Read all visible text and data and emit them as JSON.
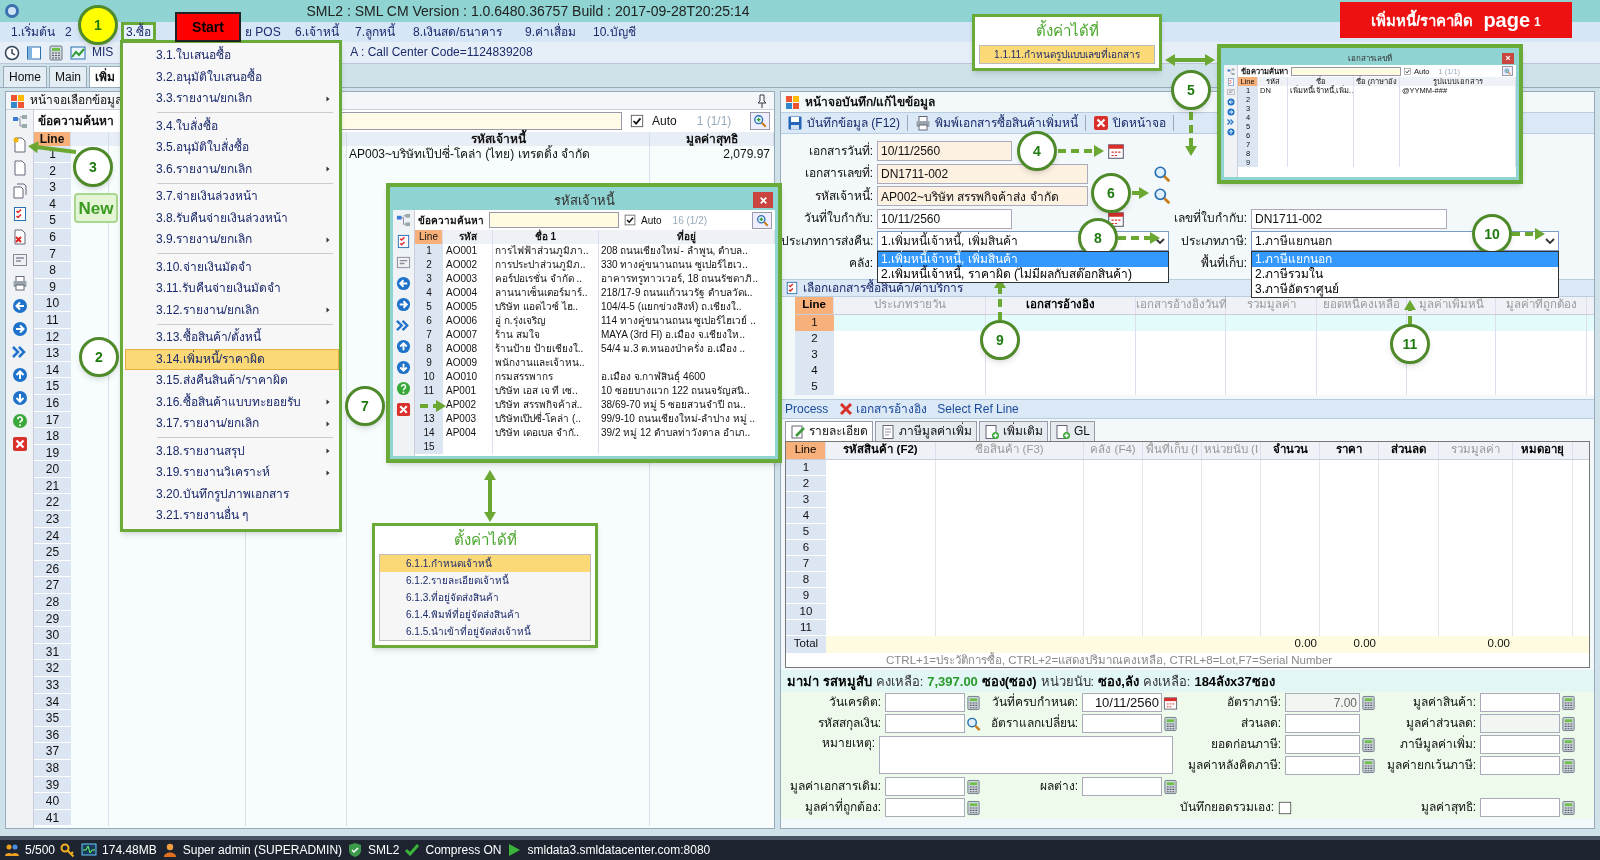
{
  "window": {
    "title": "SML2 : SML CM Version : 1.0.6480.36757  Build : 2017-09-28T20:25:14"
  },
  "menu_bar": [
    {
      "label": "1.เริ่มต้น",
      "selected": false
    },
    {
      "label": "2",
      "selected": false
    },
    {
      "label": "3.ซื้อ",
      "selected": true
    },
    {
      "label": "ย POS",
      "selected": false
    },
    {
      "label": "6.เจ้าหนี้",
      "selected": false
    },
    {
      "label": "7.ลูกหนี้",
      "selected": false
    },
    {
      "label": "8.เงินสด/ธนาคาร",
      "selected": false
    },
    {
      "label": "9.ค่าเสื่อม",
      "selected": false
    },
    {
      "label": "10.บัญชี",
      "selected": false
    }
  ],
  "toolbar": {
    "mis_label": "MIS",
    "info": "A : Call Center Code=1124839208"
  },
  "tabs": [
    {
      "label": "Home",
      "selected": false
    },
    {
      "label": "Main",
      "selected": false
    },
    {
      "label": "เพิ่ม",
      "selected": true
    }
  ],
  "left_panel": {
    "title": "หน้าจอเลือกข้อมูล",
    "search_label": "ข้อความค้นหา",
    "auto": {
      "label": "Auto",
      "checked": true
    },
    "count": "1 (1/1)",
    "columns": [
      "Line",
      "รหัสเจ้าหนี้",
      "มูลค่าสุทธิ"
    ],
    "rows": [
      {
        "code": "AP003~บริษัทเป๊ปซี่-โคล่า (ไทย) เทรดดิ้ง จำกัด",
        "amount": "2,079.97"
      }
    ],
    "lines": [
      "1",
      "2",
      "3",
      "4",
      "5",
      "6",
      "7",
      "8",
      "9",
      "10",
      "11",
      "12",
      "13",
      "14",
      "15",
      "16",
      "17",
      "18",
      "19",
      "20",
      "21",
      "22",
      "23",
      "24",
      "25",
      "26",
      "27",
      "28",
      "29",
      "30",
      "31",
      "32",
      "33",
      "34",
      "35",
      "36",
      "37",
      "38",
      "39",
      "40",
      "41"
    ]
  },
  "purchase_menu": {
    "groups": [
      [
        {
          "label": "3.1.ใบเสนอซื้อ",
          "submenu": false,
          "selected": false
        },
        {
          "label": "3.2.อนุมัติใบเสนอซื้อ",
          "submenu": false,
          "selected": false
        },
        {
          "label": "3.3.รายงาน/ยกเลิก",
          "submenu": true,
          "selected": false
        }
      ],
      [
        {
          "label": "3.4.ใบสั่งซื้อ",
          "submenu": false,
          "selected": false
        },
        {
          "label": "3.5.อนุมัติใบสั่งซื้อ",
          "submenu": false,
          "selected": false
        },
        {
          "label": "3.6.รายงาน/ยกเลิก",
          "submenu": true,
          "selected": false
        }
      ],
      [
        {
          "label": "3.7.จ่ายเงินล่วงหน้า",
          "submenu": false,
          "selected": false
        },
        {
          "label": "3.8.รับคืนจ่ายเงินล่วงหน้า",
          "submenu": false,
          "selected": false
        },
        {
          "label": "3.9.รายงาน/ยกเลิก",
          "submenu": true,
          "selected": false
        }
      ],
      [
        {
          "label": "3.10.จ่ายเงินมัดจำ",
          "submenu": false,
          "selected": false
        },
        {
          "label": "3.11.รับคืนจ่ายเงินมัดจำ",
          "submenu": false,
          "selected": false
        },
        {
          "label": "3.12.รายงาน/ยกเลิก",
          "submenu": true,
          "selected": false
        }
      ],
      [
        {
          "label": "3.13.ซื้อสินค้า/ตั้งหนี้",
          "submenu": false,
          "selected": false
        },
        {
          "label": "3.14.เพิ่มหนี้/ราคาผิด",
          "submenu": false,
          "selected": true
        },
        {
          "label": "3.15.ส่งคืนสินค้า/ราคาผิด",
          "submenu": false,
          "selected": false
        },
        {
          "label": "3.16.ซื้อสินค้าแบบทะยอยรับ",
          "submenu": true,
          "selected": false
        },
        {
          "label": "3.17.รายงาน/ยกเลิก",
          "submenu": true,
          "selected": false
        }
      ],
      [
        {
          "label": "3.18.รายงานสรุป",
          "submenu": true,
          "selected": false
        },
        {
          "label": "3.19.รายงานวิเคราะห์",
          "submenu": true,
          "selected": false
        },
        {
          "label": "3.20.บันทึกรูปภาพเอกสาร",
          "submenu": false,
          "selected": false
        },
        {
          "label": "3.21.รายงานอื่น ๆ",
          "submenu": false,
          "selected": false
        }
      ]
    ]
  },
  "vendor_dialog": {
    "title": "รหัสเจ้าหนี้",
    "search_label": "ข้อความค้นหา",
    "auto": {
      "label": "Auto",
      "checked": true
    },
    "count": "16 (1/2)",
    "columns": [
      "Line",
      "รหัส",
      "ชื่อ 1",
      "ที่อยู่"
    ],
    "rows": [
      {
        "line": "1",
        "code": "AO001",
        "name": "การไฟฟ้าส่วนภูมิภา..",
        "address": "208 ถนนเชียงใหม่- ลำพูน, ตำบล.."
      },
      {
        "line": "2",
        "code": "AO002",
        "name": "การประปาส่วนภูมิภ..",
        "address": "330 ทางคู่ขนานถนน ซูเปอร์ไฮเว.."
      },
      {
        "line": "3",
        "code": "AO003",
        "name": "คอร์ปอเรชั่น จำกัด ..",
        "address": "อาคารทรูทาวเวอร์, 18 ถนนรัชดาภิ.."
      },
      {
        "line": "4",
        "code": "AO004",
        "name": "ลานนาเซ็นเตอร์มาร์..",
        "address": "218/17-9 ถนนแก้วนวรัฐ ตำบลวัดเ.."
      },
      {
        "line": "5",
        "code": "AO005",
        "name": "บริษัท แอดไวซ์ ไฮ..",
        "address": "104/4-5 (แยกข่วงสิงห์) ถ.เชียงใ.."
      },
      {
        "line": "6",
        "code": "AO006",
        "name": "อู่ ก.รุ่งเจริญ",
        "address": "114 ทางคู่ขนานถนน ซูเปอร์ไฮเวย์ .."
      },
      {
        "line": "7",
        "code": "AO007",
        "name": "ร้าน สมใจ",
        "address": "MAYA (3rd Fl) อ.เมือง จ.เชียงให.."
      },
      {
        "line": "8",
        "code": "AO008",
        "name": "ร้านป้าย ป้ายเชียงใ..",
        "address": "54/4 ม.3 ต.หนองป่าครั่ง อ.เมือง .."
      },
      {
        "line": "9",
        "code": "AO009",
        "name": "พนักงานและเจ้าหน.."
      },
      {
        "line": "10",
        "code": "AO010",
        "name": "กรมสรรพากร",
        "address": "อ.เมือง จ.กาฬสินธุ์ 4600"
      },
      {
        "line": "11",
        "code": "AP001",
        "name": "บริษัท เอส เจ ที เซ..",
        "address": "10 ซอยบางแวก 122 ถนนจรัญสนิ.."
      },
      {
        "code": "AP002",
        "name": "บริษัท สรรพกิจค้าส่..",
        "address": "38/69-70 หมู่ 5 ซอยสวนจำปี ถน.."
      },
      {
        "line": "13",
        "code": "AP003",
        "name": "บริษัทเป๊ปซี่-โคล่า (..",
        "address": "99/9-10 ถนนเชียงใหม่-ลำปาง หมู่ .."
      },
      {
        "line": "14",
        "code": "AP004",
        "name": "บริษัท เดอเบล จำกั..",
        "address": "39/2 หมู่ 12 ตำบลท่าวังตาล อำเภ.."
      },
      {
        "line": "15"
      }
    ]
  },
  "doc_dialog": {
    "title": "เอกสารเลขที่",
    "search_label": "ข้อความค้นหา",
    "auto": {
      "label": "Auto",
      "checked": true
    },
    "count": "1 (1/1)",
    "columns": [
      "Line",
      "รหัส",
      "ชื่อ",
      "ชื่อ (ภาษาอัง",
      "รูปแบบเอกสาร"
    ],
    "rows": [
      {
        "line": "1",
        "code": "DN",
        "name": "เพิ่มหนี้เจ้าหนี้,เพิ่ม..",
        "format": "@YYMM-###"
      },
      {
        "line": "2"
      },
      {
        "line": "3"
      },
      {
        "line": "4"
      },
      {
        "line": "5"
      },
      {
        "line": "6"
      },
      {
        "line": "7"
      },
      {
        "line": "8"
      },
      {
        "line": "9"
      }
    ]
  },
  "entry_panel": {
    "title": "หน้าจอบันทึก/แก้ไขข้อมูล",
    "actions": [
      {
        "kind": "save",
        "label": "บันทึกข้อมูล (F12)"
      },
      {
        "kind": "print",
        "label": "พิมพ์เอกสารซื้อสินค้าเพิ่มหนี้"
      },
      {
        "kind": "close",
        "label": "ปิดหน้าจอ"
      }
    ],
    "form_rows": [
      {
        "left": {
          "label": "เอกสารวันที่:",
          "value": "10/11/2560",
          "kind": "date",
          "required": true
        }
      },
      {
        "left": {
          "label": "เอกสารเลขที่:",
          "value": "DN1711-002",
          "kind": "lookup",
          "required": true
        }
      },
      {
        "left": {
          "label": "รหัสเจ้าหนี้:",
          "value": "AP002~บริษัท สรรพกิจค้าส่ง จำกัด",
          "kind": "lookup",
          "required": true
        }
      },
      {
        "left": {
          "label": "วันที่ใบกำกับ:",
          "value": "10/11/2560",
          "kind": "date",
          "required": false
        },
        "right": {
          "label": "เลขที่ใบกำกับ:",
          "value": "DN1711-002",
          "kind": "text",
          "required": false
        }
      },
      {
        "left": {
          "label": "ประเภทการส่งคืน:",
          "value": "1.เพิ่มหนี้เจ้าหนี้, เพิ่มสินค้า",
          "kind": "combo",
          "required": false,
          "options": [
            {
              "label": "1.เพิ่มหนี้เจ้าหนี้, เพิ่มสินค้า",
              "selected": true
            },
            {
              "label": "2.เพิ่มหนี้เจ้าหนี้, ราคาผิด (ไม่มีผลกับสต๊อกสินค้า)",
              "selected": false
            }
          ]
        },
        "right": {
          "label": "ประเภทภาษี:",
          "value": "1.ภาษีแยกนอก",
          "kind": "combo",
          "required": false,
          "options": [
            {
              "label": "1.ภาษีแยกนอก",
              "selected": true
            },
            {
              "label": "2.ภาษีรวมใน",
              "selected": false
            },
            {
              "label": "3.ภาษีอัตราศูนย์",
              "selected": false
            }
          ]
        }
      },
      {
        "left": {
          "label": "คลัง:",
          "kind": "text"
        },
        "right": {
          "label": "พื้นที่เก็บ:",
          "kind": "text"
        }
      }
    ],
    "ref_section": "เลือกเอกสารซื้อสินค้า/ค่าบริการ",
    "ref_grid": {
      "columns": [
        {
          "label": "Line",
          "editable": true
        },
        {
          "label": "ประเภทรายวัน",
          "editable": false
        },
        {
          "label": "เอกสารอ้างอิง",
          "editable": true
        },
        {
          "label": "เอกสารอ้างอิงวันที่",
          "editable": false
        },
        {
          "label": "รวมมูลค่า",
          "editable": false
        },
        {
          "label": "ยอดหนี้คงเหลือ",
          "editable": false
        },
        {
          "label": "มูลค่าเพิ่มหนี้",
          "editable": false
        },
        {
          "label": "มูลค่าที่ถูกต้อง",
          "editable": false
        }
      ],
      "rows": [
        {
          "line": "1",
          "selected": true
        },
        {
          "line": "2",
          "selected": false
        },
        {
          "line": "3",
          "selected": false
        },
        {
          "line": "4",
          "selected": false
        },
        {
          "line": "5",
          "selected": false
        }
      ]
    },
    "process_bar": [
      {
        "kind": "text",
        "label": "Process"
      },
      {
        "kind": "delete",
        "label": "เอกสารอ้างอิง"
      },
      {
        "kind": "text",
        "label": "Select Ref Line"
      }
    ],
    "detail_tabs": [
      {
        "kind": "edit",
        "label": "รายละเอียด",
        "selected": true
      },
      {
        "kind": "page",
        "label": "ภาษีมูลค่าเพิ่ม",
        "selected": false
      },
      {
        "kind": "add",
        "label": "เพิ่มเติม",
        "selected": false
      },
      {
        "kind": "add",
        "label": "GL",
        "selected": false
      }
    ],
    "item_grid": {
      "columns": [
        {
          "label": "Line",
          "editable": true
        },
        {
          "label": "รหัสสินค้า (F2)",
          "editable": true
        },
        {
          "label": "ชื่อสินค้า (F3)",
          "editable": false
        },
        {
          "label": "คลัง (F4)",
          "editable": false
        },
        {
          "label": "พื้นที่เก็บ (I",
          "editable": false
        },
        {
          "label": "หน่วยนับ (I",
          "editable": false
        },
        {
          "label": "จำนวน",
          "editable": true
        },
        {
          "label": "ราคา",
          "editable": true
        },
        {
          "label": "ส่วนลด",
          "editable": true
        },
        {
          "label": "รวมมูลค่า",
          "editable": false
        },
        {
          "label": "หมดอายุ",
          "editable": true
        }
      ],
      "lines": [
        "1",
        "2",
        "3",
        "4",
        "5",
        "6",
        "7",
        "8",
        "9",
        "10",
        "11"
      ],
      "totals": {
        "label": "Total",
        "quantity": "0.00",
        "price": "0.00",
        "amount": "0.00"
      },
      "hint": "CTRL+1=ประวัติการซื้อ, CTRL+2=แสดงปริมาณคงเหลือ, CTRL+8=Lot,F7=Serial Number"
    },
    "stock_line": [
      {
        "kind": "item",
        "text": "มาม่า รสหมูสับ"
      },
      {
        "kind": "label",
        "text": "คงเหลือ:"
      },
      {
        "kind": "qty",
        "text": "7,397.00"
      },
      {
        "kind": "value",
        "text": "ซอง(ซอง)"
      },
      {
        "kind": "label",
        "text": "หน่วยนับ:"
      },
      {
        "kind": "value",
        "text": "ซอง,ลัง"
      },
      {
        "kind": "label",
        "text": "คงเหลือ:"
      },
      {
        "kind": "value",
        "text": "184ลังx37ซอง"
      }
    ],
    "totals_form": [
      {
        "label": "วันเครดิต:",
        "kind": "calc"
      },
      {
        "label": "วันที่ครบกำหนด:",
        "value": "10/11/2560",
        "kind": "date"
      },
      {
        "label": "อัตราภาษี:",
        "value": "7.00",
        "kind": "calc",
        "disabled": true
      },
      {
        "label": "มูลค่าสินค้า:",
        "kind": "calc"
      },
      {
        "label": "รหัสสกุลเงิน:",
        "kind": "lookup"
      },
      {
        "label": "อัตราแลกเปลี่ยน:",
        "kind": "calc"
      },
      {
        "label": "ส่วนลด:",
        "kind": "text"
      },
      {
        "label": "มูลค่าส่วนลด:",
        "kind": "calc",
        "disabled": true
      },
      {
        "label": "หมายเหตุ:",
        "kind": "notes"
      },
      {
        "label": "ยอดก่อนภาษี:",
        "kind": "calc"
      },
      {
        "label": "ภาษีมูลค่าเพิ่ม:",
        "kind": "calc"
      },
      {
        "label": "มูลค่าหลังคิดภาษี:",
        "kind": "calc"
      },
      {
        "label": "มูลค่ายกเว้นภาษี:",
        "kind": "calc"
      },
      {
        "label": "มูลค่าเอกสารเดิม:",
        "kind": "calc"
      },
      {
        "label": "ผลต่าง:",
        "kind": "calc"
      },
      {
        "label": "มูลค่าที่ถูกต้อง:",
        "kind": "calc"
      },
      {
        "label": "บันทึกยอดรวมเอง:",
        "kind": "checkbox",
        "checked": false
      },
      {
        "label": "มูลค่าสุทธิ:",
        "kind": "calc"
      }
    ]
  },
  "status_bar": [
    {
      "kind": "users",
      "text": "5/500"
    },
    {
      "kind": "memory",
      "text": "174.48MB"
    },
    {
      "kind": "user",
      "text": "Super admin (SUPERADMIN)"
    },
    {
      "kind": "db",
      "text": "SML2"
    },
    {
      "kind": "compress",
      "text": "Compress ON"
    },
    {
      "kind": "server",
      "text": "smldata3.smldatacenter.com:8080"
    }
  ],
  "annotations": {
    "start_label": "Start",
    "new_label": "New",
    "banner": {
      "title": "เพิ่มหนี้/ราคาผิด",
      "page_label": "page",
      "page_number": "1"
    },
    "markers": [
      {
        "number": "1",
        "color": "#ffff00"
      },
      {
        "number": "2",
        "color": "#ffffff"
      },
      {
        "number": "3",
        "color": "#ffffff"
      },
      {
        "number": "4",
        "color": "#ffffff"
      },
      {
        "number": "5",
        "color": "#ffffff"
      },
      {
        "number": "6",
        "color": "#ffffff"
      },
      {
        "number": "7",
        "color": "#ffffff"
      },
      {
        "number": "8",
        "color": "#ffffff"
      },
      {
        "number": "9",
        "color": "#ffffff"
      },
      {
        "number": "10",
        "color": "#ffffff"
      },
      {
        "number": "11",
        "color": "#ffffff"
      }
    ],
    "settings_callouts": [
      {
        "title": "ตั้งค่าได้ที่",
        "items": [
          {
            "label": "1.1.11.กำหนดรูปแบบเลขที่เอกสาร",
            "selected": true
          }
        ]
      },
      {
        "title": "ตั้งค่าได้ที่",
        "items": [
          {
            "label": "6.1.1.กำหนดเจ้าหนี้",
            "selected": true
          },
          {
            "label": "6.1.2.รายละเอียดเจ้าหนี้",
            "selected": false
          },
          {
            "label": "6.1.3.ที่อยู่จัดส่งสินค้า",
            "selected": false
          },
          {
            "label": "6.1.4.พิมพ์ที่อยู่จัดส่งสินค้า",
            "selected": false
          },
          {
            "label": "6.1.5.นำเข้าที่อยู่จัดส่งเจ้าหนี้",
            "selected": false
          }
        ]
      }
    ]
  }
}
